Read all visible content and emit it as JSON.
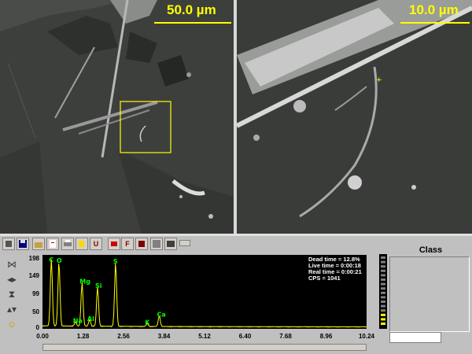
{
  "sem_left": {
    "scale_label": "50.0 µm"
  },
  "sem_right": {
    "scale_label": "10.0 µm"
  },
  "toolbar": {
    "buttons": [
      "save",
      "open",
      "report",
      "print",
      "copy",
      "peak-id",
      "f",
      "stop",
      "grid",
      "display"
    ]
  },
  "toolbar_labels": {
    "f": "F",
    "u": "U"
  },
  "spectrum": {
    "dead_time": "Dead time = 12.8%",
    "live_time": "Live time = 0:00:18",
    "real_time": "Real time = 0:00:21",
    "cps": "CPS = 1041",
    "y_ticks": [
      "198",
      "149",
      "99",
      "50",
      "0"
    ],
    "x_ticks": [
      "0.00",
      "1.28",
      "2.56",
      "3.84",
      "5.12",
      "6.40",
      "7.68",
      "8.96",
      "10.24"
    ],
    "peak_labels": [
      "C",
      "O",
      "Na",
      "Mg",
      "Al",
      "Si",
      "S",
      "K",
      "Ca"
    ],
    "colors": {
      "trace": "#ffff00",
      "labels": "#00ff00",
      "background": "#000000"
    }
  },
  "chart_data": {
    "type": "line",
    "x_range": [
      0,
      10.24
    ],
    "y_range": [
      0,
      198
    ],
    "peaks": [
      {
        "element": "C",
        "x": 0.28,
        "y": 188
      },
      {
        "element": "O",
        "x": 0.52,
        "y": 180
      },
      {
        "element": "Na",
        "x": 1.04,
        "y": 12
      },
      {
        "element": "Mg",
        "x": 1.25,
        "y": 122
      },
      {
        "element": "Al",
        "x": 1.49,
        "y": 18
      },
      {
        "element": "Si",
        "x": 1.74,
        "y": 110
      },
      {
        "element": "S",
        "x": 2.31,
        "y": 178
      },
      {
        "element": "K",
        "x": 3.31,
        "y": 8
      },
      {
        "element": "Ca",
        "x": 3.69,
        "y": 30
      }
    ]
  },
  "class_panel": {
    "title": "Class"
  }
}
